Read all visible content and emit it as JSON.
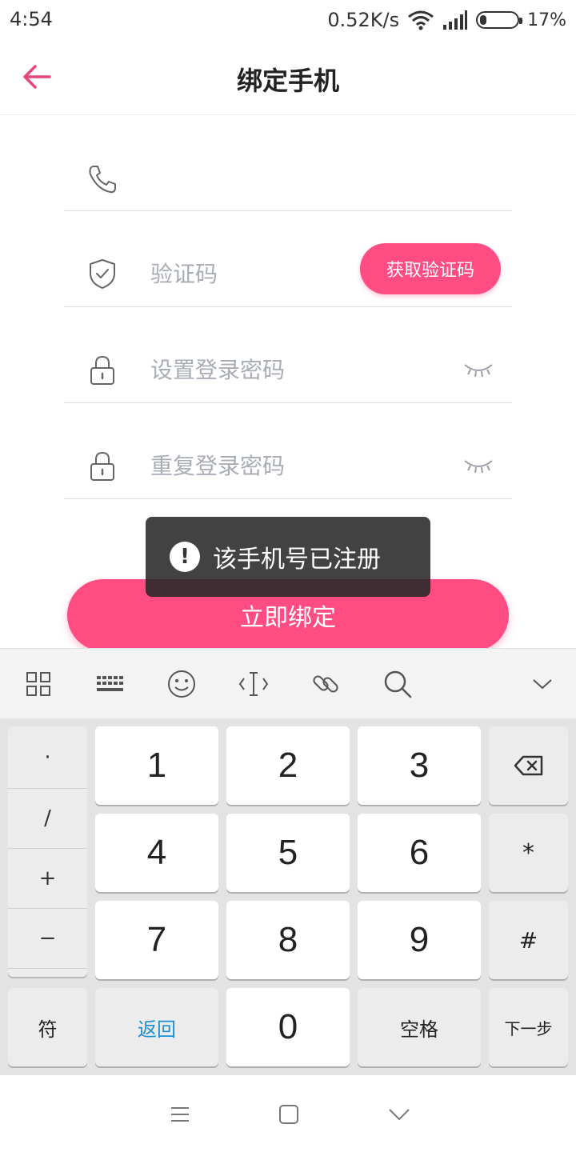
{
  "status_bar": {
    "time": "4:54",
    "net_speed": "0.52K/s",
    "battery_percent": "17%",
    "battery_level": 0.17
  },
  "header": {
    "title": "绑定手机",
    "back_icon": "arrow-left-icon",
    "accent_color": "#e8457c"
  },
  "form": {
    "phone": {
      "value": "",
      "placeholder": "",
      "icon": "phone-icon"
    },
    "code": {
      "placeholder": "验证码",
      "icon": "shield-check-icon",
      "button_label": "获取验证码"
    },
    "password": {
      "placeholder": "设置登录密码",
      "icon": "lock-icon",
      "toggle_icon": "eye-closed-icon"
    },
    "password_repeat": {
      "placeholder": "重复登录密码",
      "icon": "lock-icon",
      "toggle_icon": "eye-closed-icon"
    },
    "submit_label": "立即绑定",
    "button_color": "#ff4d84"
  },
  "toast": {
    "icon": "exclamation-circle-icon",
    "message": "该手机号已注册"
  },
  "keyboard": {
    "toolbar_icons": [
      "grid-icon",
      "keyboard-icon",
      "emoji-icon",
      "cursor-icon",
      "link-icon",
      "search-icon",
      "chevron-down-icon"
    ],
    "symbols": [
      "·",
      "/",
      "+",
      "−"
    ],
    "digits": [
      "1",
      "2",
      "3",
      "4",
      "5",
      "6",
      "7",
      "8",
      "9",
      "0"
    ],
    "backspace_icon": "backspace-icon",
    "star": "*",
    "hash": "#",
    "symbols_key": "符",
    "back_key": "返回",
    "space_key": "空格",
    "next_key": "下一步"
  },
  "nav_bar": {
    "icons": [
      "menu-icon",
      "home-icon",
      "back-chevron-icon"
    ]
  }
}
